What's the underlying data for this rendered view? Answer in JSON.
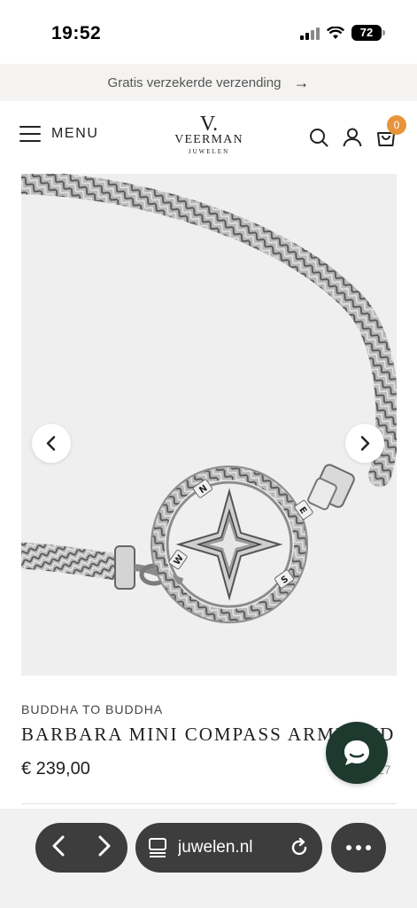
{
  "status_bar": {
    "time": "19:52",
    "battery": "72"
  },
  "announcement": {
    "text": "Gratis verzekerde verzending",
    "arrow": "→"
  },
  "header": {
    "menu_label": "MENU",
    "logo": {
      "mark": "V.",
      "name": "VEERMAN",
      "sub": "JUWELEN"
    },
    "cart_count": "0"
  },
  "product": {
    "brand": "BUDDHA TO BUDDHA",
    "title": "BARBARA MINI COMPASS ARMBAND",
    "price": "€ 239,00",
    "side_text": "27",
    "compass_letters": {
      "n": "N",
      "e": "E",
      "w": "W",
      "s": "S"
    }
  },
  "browser": {
    "url": "juwelen.nl"
  },
  "icons": {
    "hamburger": "hamburger-icon",
    "search": "search-icon",
    "account": "user-icon",
    "cart": "cart-icon",
    "prev": "chevron-left-icon",
    "next": "chevron-right-icon",
    "chat": "chat-bubble-icon",
    "tabs": "tabs-icon",
    "reload": "reload-icon",
    "more": "more-icon"
  },
  "colors": {
    "accent_badge": "#e8943b",
    "chat_button": "#1e3a2f",
    "browser_pill": "#3d3d3d"
  }
}
